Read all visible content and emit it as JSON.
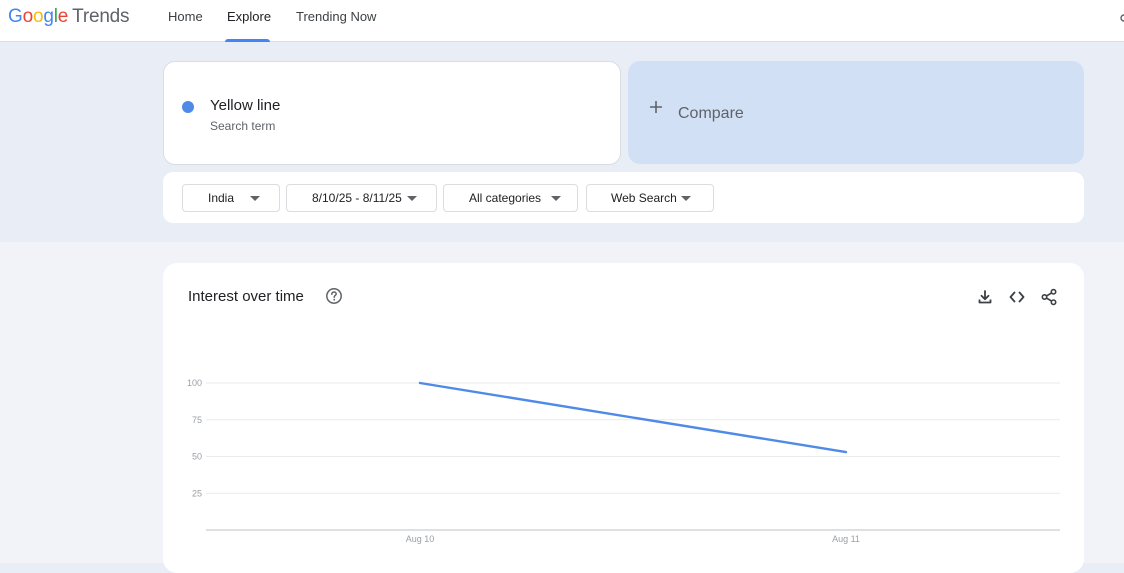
{
  "header": {
    "logo_google": "Google",
    "logo_trends": "Trends",
    "nav": [
      {
        "label": "Home"
      },
      {
        "label": "Explore"
      },
      {
        "label": "Trending Now"
      }
    ],
    "active_tab": "Explore"
  },
  "search": {
    "term": "Yellow line",
    "term_subtitle": "Search term",
    "term_color": "#4f8ae8",
    "compare_label": "Compare"
  },
  "filters": {
    "region": "India",
    "date_range": "8/10/25 - 8/11/25",
    "category": "All categories",
    "search_type": "Web Search"
  },
  "chart_panel": {
    "title": "Interest over time",
    "icons": [
      "help-icon",
      "download-icon",
      "embed-icon",
      "share-icon"
    ]
  },
  "chart_data": {
    "type": "line",
    "x": [
      "Aug 10",
      "Aug 11"
    ],
    "series": [
      {
        "name": "Yellow line",
        "color": "#4f8ae8",
        "values": [
          100,
          53
        ]
      }
    ],
    "yticks": [
      100,
      75,
      50,
      25
    ],
    "ylim": [
      0,
      100
    ],
    "grid": true
  }
}
